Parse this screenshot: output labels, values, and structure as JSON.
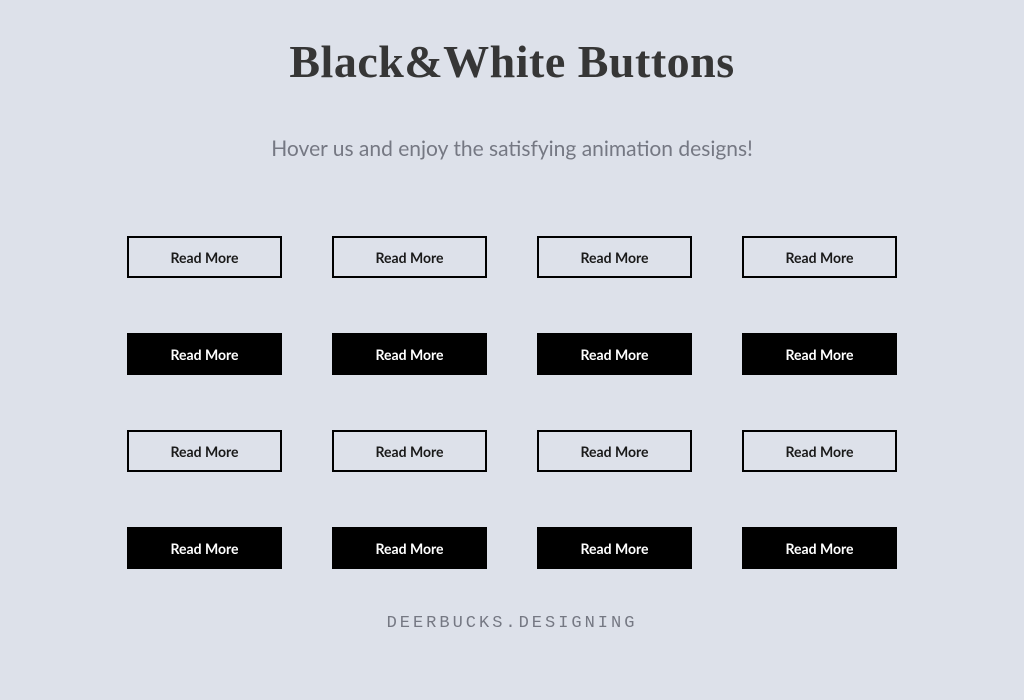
{
  "title": "Black&White Buttons",
  "subtitle": "Hover us and enjoy the satisfying animation designs!",
  "buttons": {
    "row1": [
      {
        "label": "Read More",
        "style": "outline"
      },
      {
        "label": "Read More",
        "style": "outline"
      },
      {
        "label": "Read More",
        "style": "outline"
      },
      {
        "label": "Read More",
        "style": "outline"
      }
    ],
    "row2": [
      {
        "label": "Read More",
        "style": "filled"
      },
      {
        "label": "Read More",
        "style": "filled"
      },
      {
        "label": "Read More",
        "style": "filled"
      },
      {
        "label": "Read More",
        "style": "filled"
      }
    ],
    "row3": [
      {
        "label": "Read More",
        "style": "outline"
      },
      {
        "label": "Read More",
        "style": "outline"
      },
      {
        "label": "Read More",
        "style": "outline"
      },
      {
        "label": "Read More",
        "style": "outline"
      }
    ],
    "row4": [
      {
        "label": "Read More",
        "style": "filled"
      },
      {
        "label": "Read More",
        "style": "filled"
      },
      {
        "label": "Read More",
        "style": "filled"
      },
      {
        "label": "Read More",
        "style": "filled"
      }
    ]
  },
  "footer": "DEERBUCKS.DESIGNING",
  "colors": {
    "background": "#dde1ea",
    "text_dark": "#363636",
    "text_muted": "#757883",
    "black": "#000000",
    "white": "#ffffff"
  }
}
